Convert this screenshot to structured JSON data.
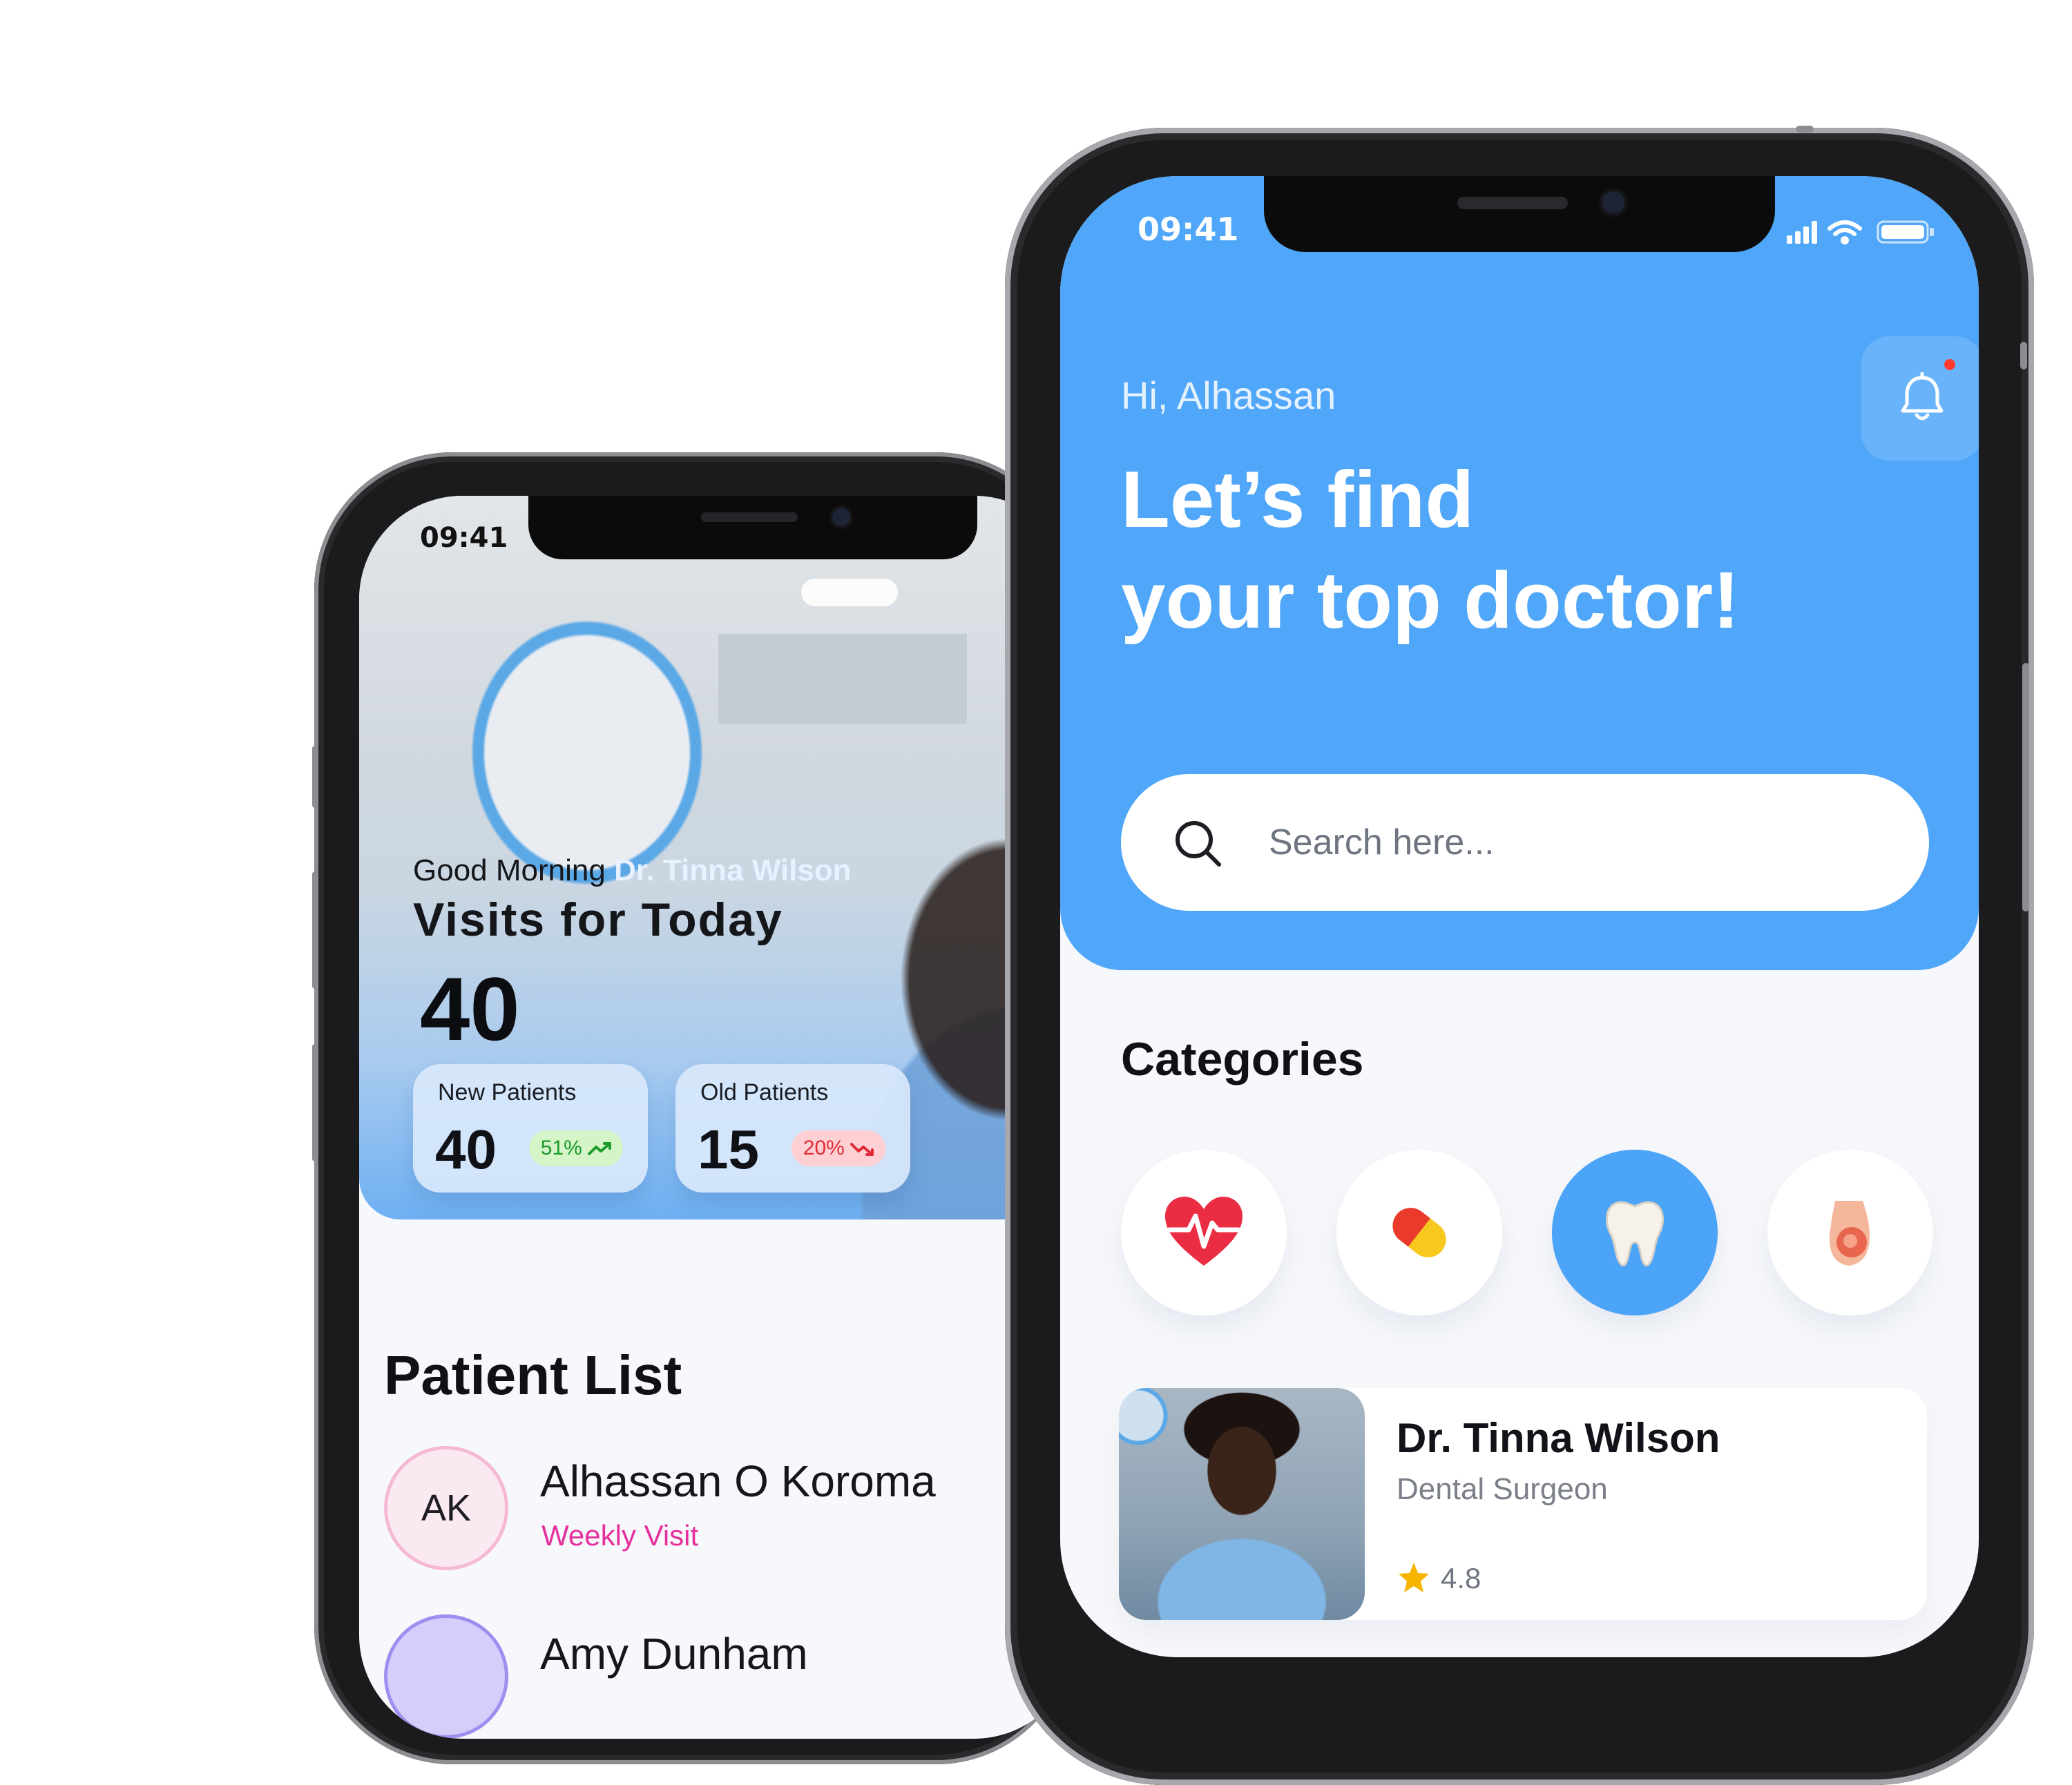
{
  "left_phone": {
    "status_time": "09:41",
    "greeting_prefix": "Good Morning",
    "greeting_name": "Dr. Tinna Wilson",
    "visits_title": "Visits for Today",
    "visits_count": "40",
    "stats": {
      "new": {
        "label": "New Patients",
        "count": "40",
        "change": "51%",
        "trend": "up",
        "color": "#1c9b2b"
      },
      "old": {
        "label": "Old Patients",
        "count": "15",
        "change": "20%",
        "trend": "down",
        "color": "#e02b37"
      }
    },
    "patient_list_title": "Patient List",
    "patients": [
      {
        "initials": "AK",
        "name": "Alhassan O Koroma",
        "visit_type": "Weekly Visit"
      },
      {
        "name": "Amy Dunham"
      }
    ]
  },
  "right_phone": {
    "status_time": "09:41",
    "greeting": "Hi, Alhassan",
    "headline": "Let’s find\nyour top doctor!",
    "search": {
      "placeholder": "Search here..."
    },
    "categories_title": "Categories",
    "categories": [
      {
        "icon": "heart-pulse-icon",
        "selected": false
      },
      {
        "icon": "pill-icon",
        "selected": false
      },
      {
        "icon": "tooth-icon",
        "selected": true
      },
      {
        "icon": "pregnancy-icon",
        "selected": false
      }
    ],
    "doctor": {
      "name": "Dr. Tinna Wilson",
      "specialty": "Dental Surgeon",
      "rating": "4.8"
    }
  },
  "colors": {
    "primary_blue": "#50a6f8",
    "accent_pink": "#e5309c",
    "up_green": "#1c9b2b",
    "down_red": "#e02b37",
    "star": "#f7b500"
  }
}
